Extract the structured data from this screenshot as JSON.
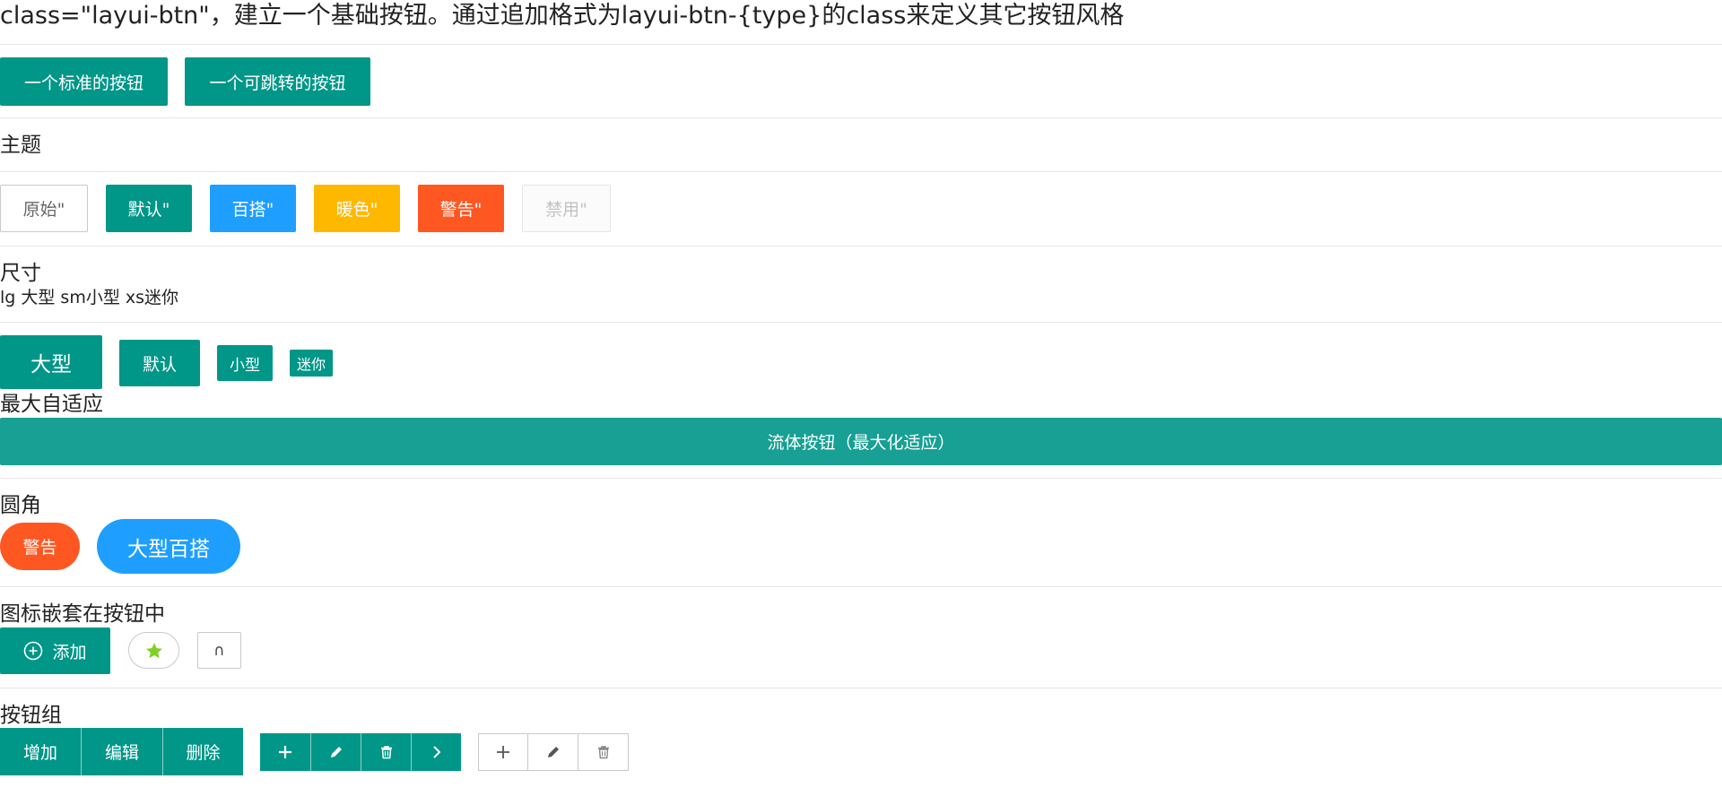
{
  "intro": "class=\"layui-btn\"，建立一个基础按钮。通过追加格式为layui-btn-{type}的class来定义其它按钮风格",
  "basic": {
    "standard": "一个标准的按钮",
    "link": "一个可跳转的按钮"
  },
  "theme": {
    "heading": "主题",
    "primary": "原始\"",
    "default": "默认\"",
    "normal": "百搭\"",
    "warm": "暖色\"",
    "danger": "警告\"",
    "disabled": "禁用\""
  },
  "size": {
    "heading": "尺寸",
    "desc": "lg 大型 sm小型 xs迷你",
    "large": "大型",
    "default": "默认",
    "small": "小型",
    "mini": "迷你"
  },
  "fluid": {
    "heading": "最大自适应",
    "label": "流体按钮（最大化适应）"
  },
  "radius": {
    "heading": "圆角",
    "danger": "警告",
    "large_normal": "大型百搭"
  },
  "icons": {
    "heading": "图标嵌套在按钮中",
    "add_label": "添加",
    "add_icon": "add-circle-icon",
    "star_icon": "star-icon",
    "unknown_glyph": "∩",
    "star_color": "#5FB878"
  },
  "groups": {
    "heading": "按钮组",
    "text_buttons": [
      "增加",
      "编辑",
      "删除"
    ],
    "icon_buttons": [
      "plus-icon",
      "edit-icon",
      "trash-icon",
      "chevron-right-icon"
    ],
    "light_icon_buttons": [
      "plus-icon",
      "edit-icon",
      "trash-icon"
    ]
  },
  "colors": {
    "default": "#009688",
    "normal": "#1E9FFF",
    "warm": "#FFB800",
    "danger": "#FF5722",
    "disabled_bg": "#FBFBFB"
  }
}
